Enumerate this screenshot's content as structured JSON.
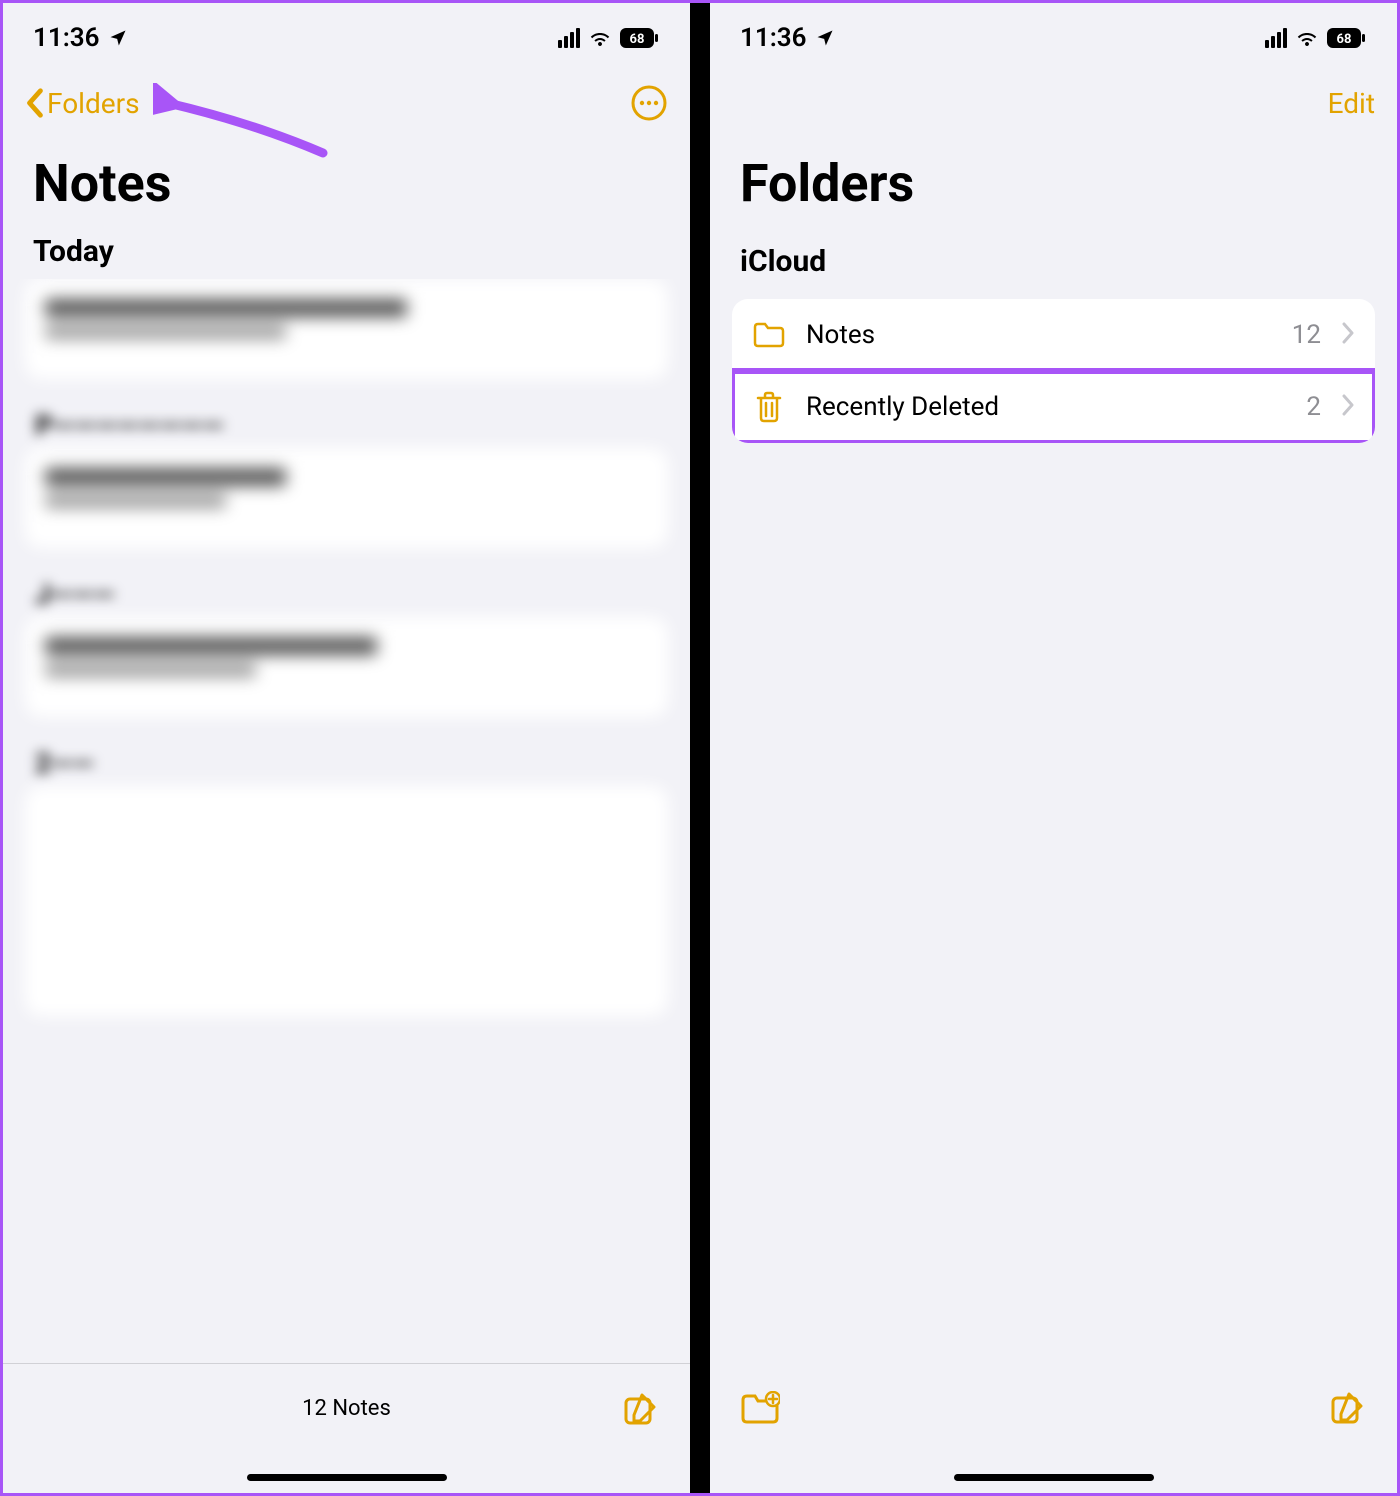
{
  "status": {
    "time": "11:36",
    "battery_level": "68"
  },
  "accent_color": "#E2A300",
  "highlight_color": "#a855f7",
  "left_screen": {
    "back_label": "Folders",
    "title": "Notes",
    "section_today": "Today",
    "section_labels_blurred": [
      "P",
      "J",
      "2"
    ],
    "toolbar_count": "12 Notes"
  },
  "right_screen": {
    "edit_label": "Edit",
    "title": "Folders",
    "section_header": "iCloud",
    "folders": [
      {
        "icon": "folder-icon",
        "label": "Notes",
        "count": "12",
        "highlighted": false
      },
      {
        "icon": "trash-icon",
        "label": "Recently Deleted",
        "count": "2",
        "highlighted": true
      }
    ]
  }
}
